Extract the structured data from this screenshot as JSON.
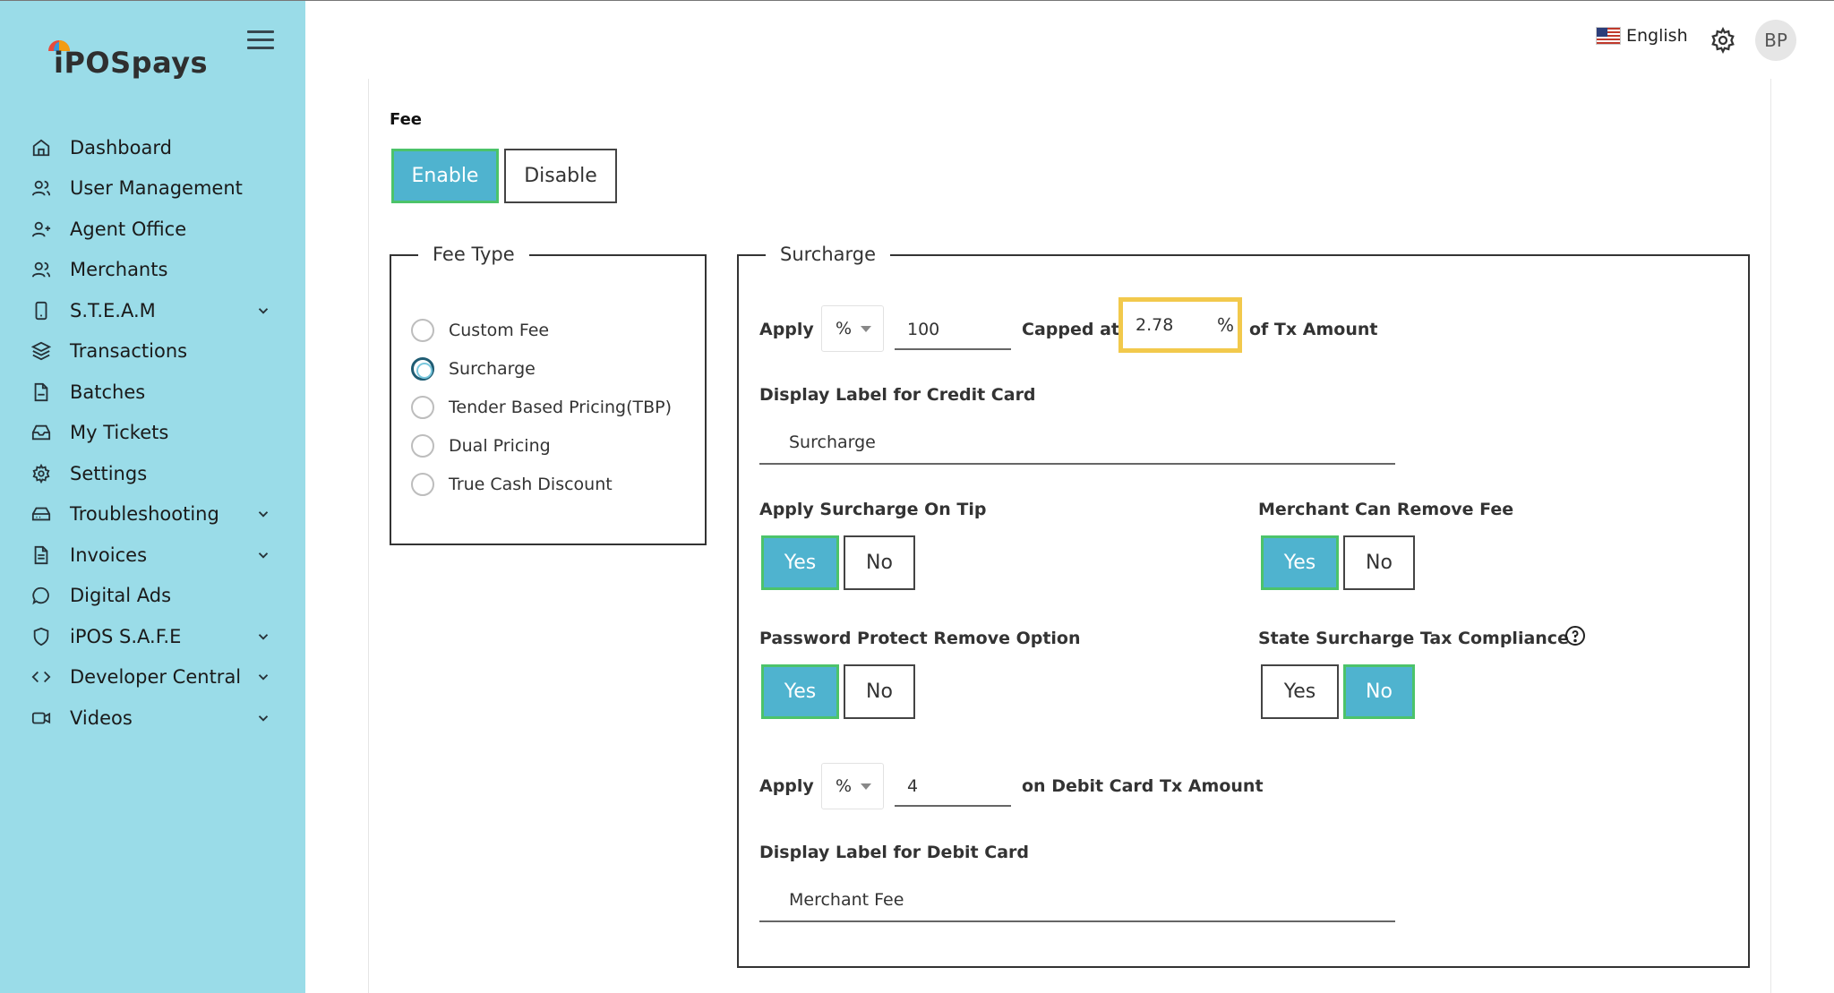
{
  "brand": {
    "logo_text": "iPOSpays"
  },
  "header": {
    "language": "English",
    "avatar_initials": "BP"
  },
  "nav": {
    "items": [
      {
        "label": "Dashboard",
        "icon": "home-icon",
        "has_chevron": false
      },
      {
        "label": "User Management",
        "icon": "users-icon",
        "has_chevron": false
      },
      {
        "label": "Agent Office",
        "icon": "user-plus-icon",
        "has_chevron": false
      },
      {
        "label": "Merchants",
        "icon": "users-icon",
        "has_chevron": false
      },
      {
        "label": "S.T.E.A.M",
        "icon": "tablet-icon",
        "has_chevron": true
      },
      {
        "label": "Transactions",
        "icon": "layers-icon",
        "has_chevron": false
      },
      {
        "label": "Batches",
        "icon": "file-icon",
        "has_chevron": false
      },
      {
        "label": "My Tickets",
        "icon": "inbox-icon",
        "has_chevron": false
      },
      {
        "label": "Settings",
        "icon": "gear-icon",
        "has_chevron": false
      },
      {
        "label": "Troubleshooting",
        "icon": "hard-drive-icon",
        "has_chevron": true
      },
      {
        "label": "Invoices",
        "icon": "file-text-icon",
        "has_chevron": true
      },
      {
        "label": "Digital Ads",
        "icon": "chat-bubble-icon",
        "has_chevron": false
      },
      {
        "label": "iPOS S.A.F.E",
        "icon": "shield-icon",
        "has_chevron": true
      },
      {
        "label": "Developer Central",
        "icon": "code-icon",
        "has_chevron": true
      },
      {
        "label": "Videos",
        "icon": "video-icon",
        "has_chevron": true
      }
    ]
  },
  "fee": {
    "label": "Fee",
    "enable_label": "Enable",
    "disable_label": "Disable",
    "selected": "Enable"
  },
  "fee_type": {
    "legend": "Fee Type",
    "options": [
      "Custom Fee",
      "Surcharge",
      "Tender Based Pricing(TBP)",
      "Dual Pricing",
      "True Cash Discount"
    ],
    "selected": "Surcharge"
  },
  "surcharge": {
    "legend": "Surcharge",
    "apply_label": "Apply",
    "apply_unit": "%",
    "apply_value": "100",
    "capped_label": "Capped at",
    "capped_value": "2.78",
    "capped_unit": "%",
    "of_tx_label": "of Tx Amount",
    "credit_label_title": "Display Label for Credit Card",
    "credit_label_value": "Surcharge",
    "apply_on_tip": {
      "title": "Apply Surcharge On Tip",
      "yes": "Yes",
      "no": "No",
      "selected": "Yes"
    },
    "merchant_remove": {
      "title": "Merchant Can Remove Fee",
      "yes": "Yes",
      "no": "No",
      "selected": "Yes"
    },
    "password_protect": {
      "title": "Password Protect Remove Option",
      "yes": "Yes",
      "no": "No",
      "selected": "Yes"
    },
    "state_compliance": {
      "title": "State Surcharge Tax Compliance",
      "yes": "Yes",
      "no": "No",
      "selected": "No"
    },
    "debit_apply_label": "Apply",
    "debit_unit": "%",
    "debit_value": "4",
    "debit_tx_label": "on Debit Card Tx Amount",
    "debit_label_title": "Display Label for Debit Card",
    "debit_label_value": "Merchant Fee"
  },
  "colors": {
    "sidebar": "#9adce8",
    "active_button": "#4fb3cf",
    "active_border": "#4cc36a",
    "highlight": "#f2c94c"
  }
}
